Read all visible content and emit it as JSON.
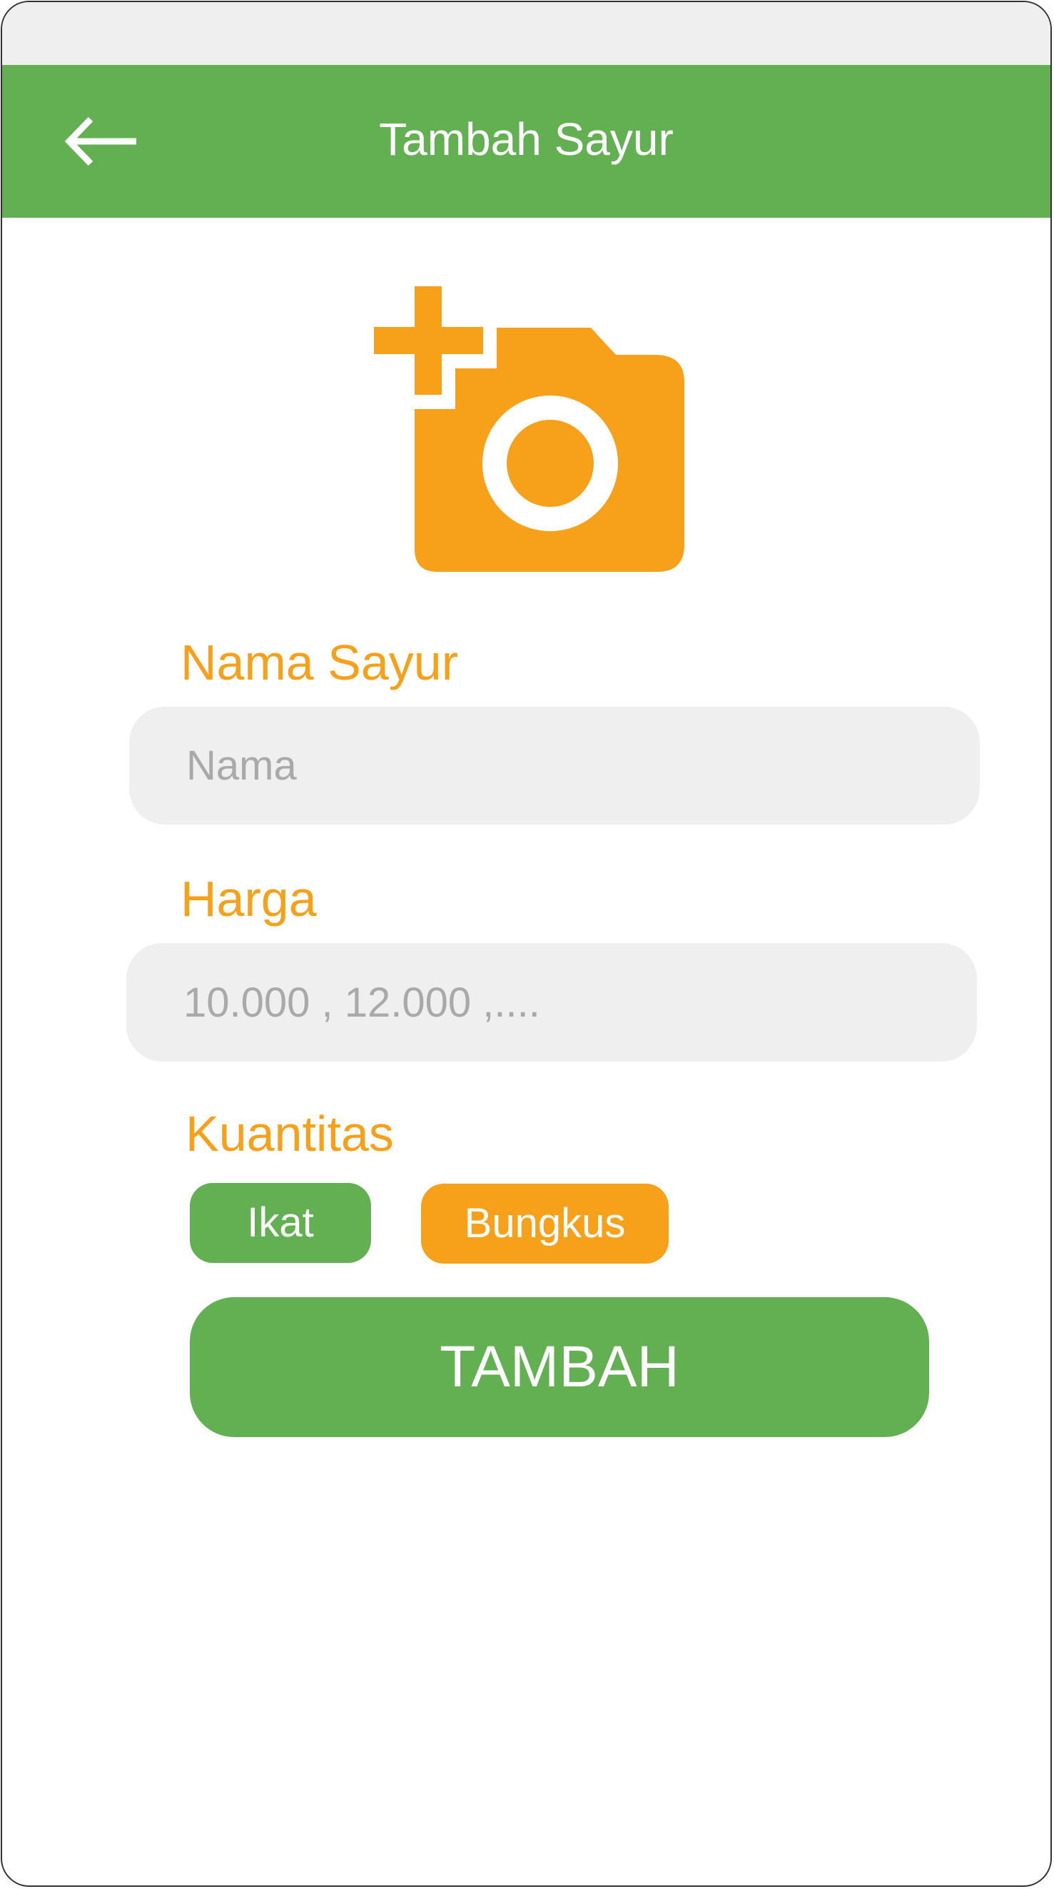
{
  "header": {
    "title": "Tambah Sayur",
    "back_icon": "arrow-left-icon"
  },
  "photo": {
    "icon": "add-a-photo-icon"
  },
  "form": {
    "name": {
      "label": "Nama Sayur",
      "placeholder": "Nama",
      "value": ""
    },
    "price": {
      "label": "Harga",
      "placeholder": "10.000 , 12.000 ,....",
      "value": ""
    },
    "quantity": {
      "label": "Kuantitas",
      "options": [
        {
          "label": "Ikat",
          "color": "#63b053"
        },
        {
          "label": "Bungkus",
          "color": "#f7a11b"
        }
      ]
    },
    "submit_label": "TAMBAH"
  },
  "colors": {
    "primary": "#63b053",
    "accent": "#f7a11b",
    "field_bg": "#efefef",
    "status_bar": "#efefef",
    "placeholder": "#a9a9a9"
  }
}
